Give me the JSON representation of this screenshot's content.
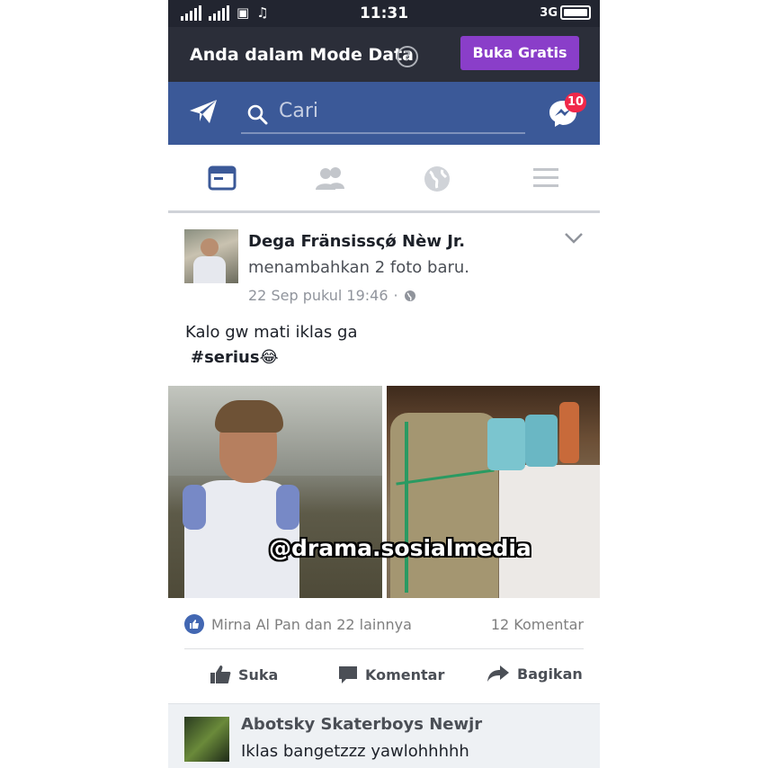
{
  "status_bar": {
    "time": "11:31",
    "network": "3G"
  },
  "data_mode": {
    "message": "Anda dalam Mode Data",
    "help": "?",
    "button": "Buka Gratis"
  },
  "header": {
    "search_placeholder": "Cari",
    "messenger_badge": "10"
  },
  "tabs": [
    {
      "icon": "news-feed-icon",
      "active": true
    },
    {
      "icon": "friends-icon",
      "active": false
    },
    {
      "icon": "globe-icon",
      "active": false
    },
    {
      "icon": "menu-icon",
      "active": false
    }
  ],
  "post": {
    "author": "Dega Fränsissςǿ Nèw Jr.",
    "action": "menambahkan 2 foto baru.",
    "time": "22 Sep pukul 19:46",
    "separator": "·",
    "text_line1": "Kalo gw mati iklas ga",
    "text_line2": "#serius😂",
    "watermark": "@drama.sosialmedia",
    "likes": "Mirna Al Pan dan 22 lainnya",
    "comments": "12 Komentar",
    "actions": {
      "like": "Suka",
      "comment": "Komentar",
      "share": "Bagikan"
    }
  },
  "comment": {
    "author": "Abotsky Skaterboys Newjr",
    "text": "Iklas bangetzzz yawlohhhhh"
  },
  "colors": {
    "facebook_blue": "#3b5998",
    "status_bar": "#222530",
    "button_purple": "#8a3ec9",
    "badge_red": "#f0284a"
  }
}
